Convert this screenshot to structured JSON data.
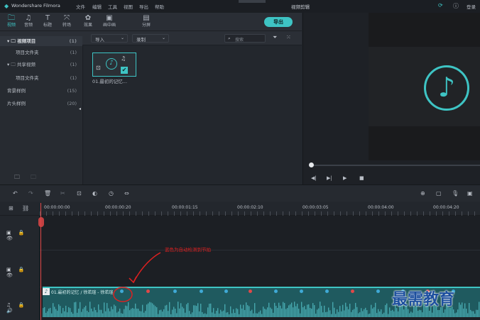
{
  "window": {
    "app_name": "Wondershare Filmora",
    "menu": [
      "文件",
      "编辑",
      "工具",
      "视图",
      "导出",
      "帮助"
    ],
    "project_title": "视频剪辑",
    "right_icons": [
      "sync-icon",
      "help-icon"
    ],
    "login_label": "登录"
  },
  "toolbar": {
    "tabs": [
      {
        "label": "视频",
        "icon": "媒",
        "active": true
      },
      {
        "label": "音频",
        "icon": "♫",
        "active": false
      },
      {
        "label": "标题",
        "icon": "T",
        "active": false
      },
      {
        "label": "转场",
        "icon": "⤧",
        "active": false
      },
      {
        "label": "效果",
        "icon": "✿",
        "active": false
      },
      {
        "label": "画中画",
        "icon": "▣",
        "active": false
      },
      {
        "label": "分屏",
        "icon": "▤",
        "active": false
      }
    ],
    "export_label": "导出"
  },
  "media_bar": {
    "import_label": "导入",
    "record_label": "录制",
    "search_placeholder": "搜索"
  },
  "sidebar": {
    "items": [
      {
        "label": "▾ 🗀 视频项目",
        "count": "(1)",
        "indent": 0,
        "bold": true
      },
      {
        "label": "项目文件夹",
        "count": "(1)",
        "indent": 1,
        "bold": false
      },
      {
        "label": "▾ 🗀 共享视频",
        "count": "(1)",
        "indent": 0,
        "bold": false
      },
      {
        "label": "项目文件夹",
        "count": "(1)",
        "indent": 1,
        "bold": false
      },
      {
        "label": "背景样例",
        "count": "(15)",
        "indent": 0,
        "bold": false
      },
      {
        "label": "片头样例",
        "count": "(20)",
        "indent": 0,
        "bold": false
      }
    ]
  },
  "library": {
    "clip_name": "01.最初的记忆..."
  },
  "timeline": {
    "timecodes": [
      "00:00:00:00",
      "00:00:00:20",
      "00:00:01:15",
      "00:00:02:10",
      "00:00:03:05",
      "00:00:04:00",
      "00:00:04:20"
    ],
    "audio_clip_name": "01.最初的记忆 / 徐若瑄 - 徐若瑄"
  },
  "annotation": {
    "text": "蓝色为自动检测到节拍"
  },
  "watermark": "最需教育",
  "colors": {
    "accent": "#3ec4c4",
    "beat_blue": "#3fa9d6",
    "beat_red": "#e04848",
    "annotation": "#e02020"
  }
}
